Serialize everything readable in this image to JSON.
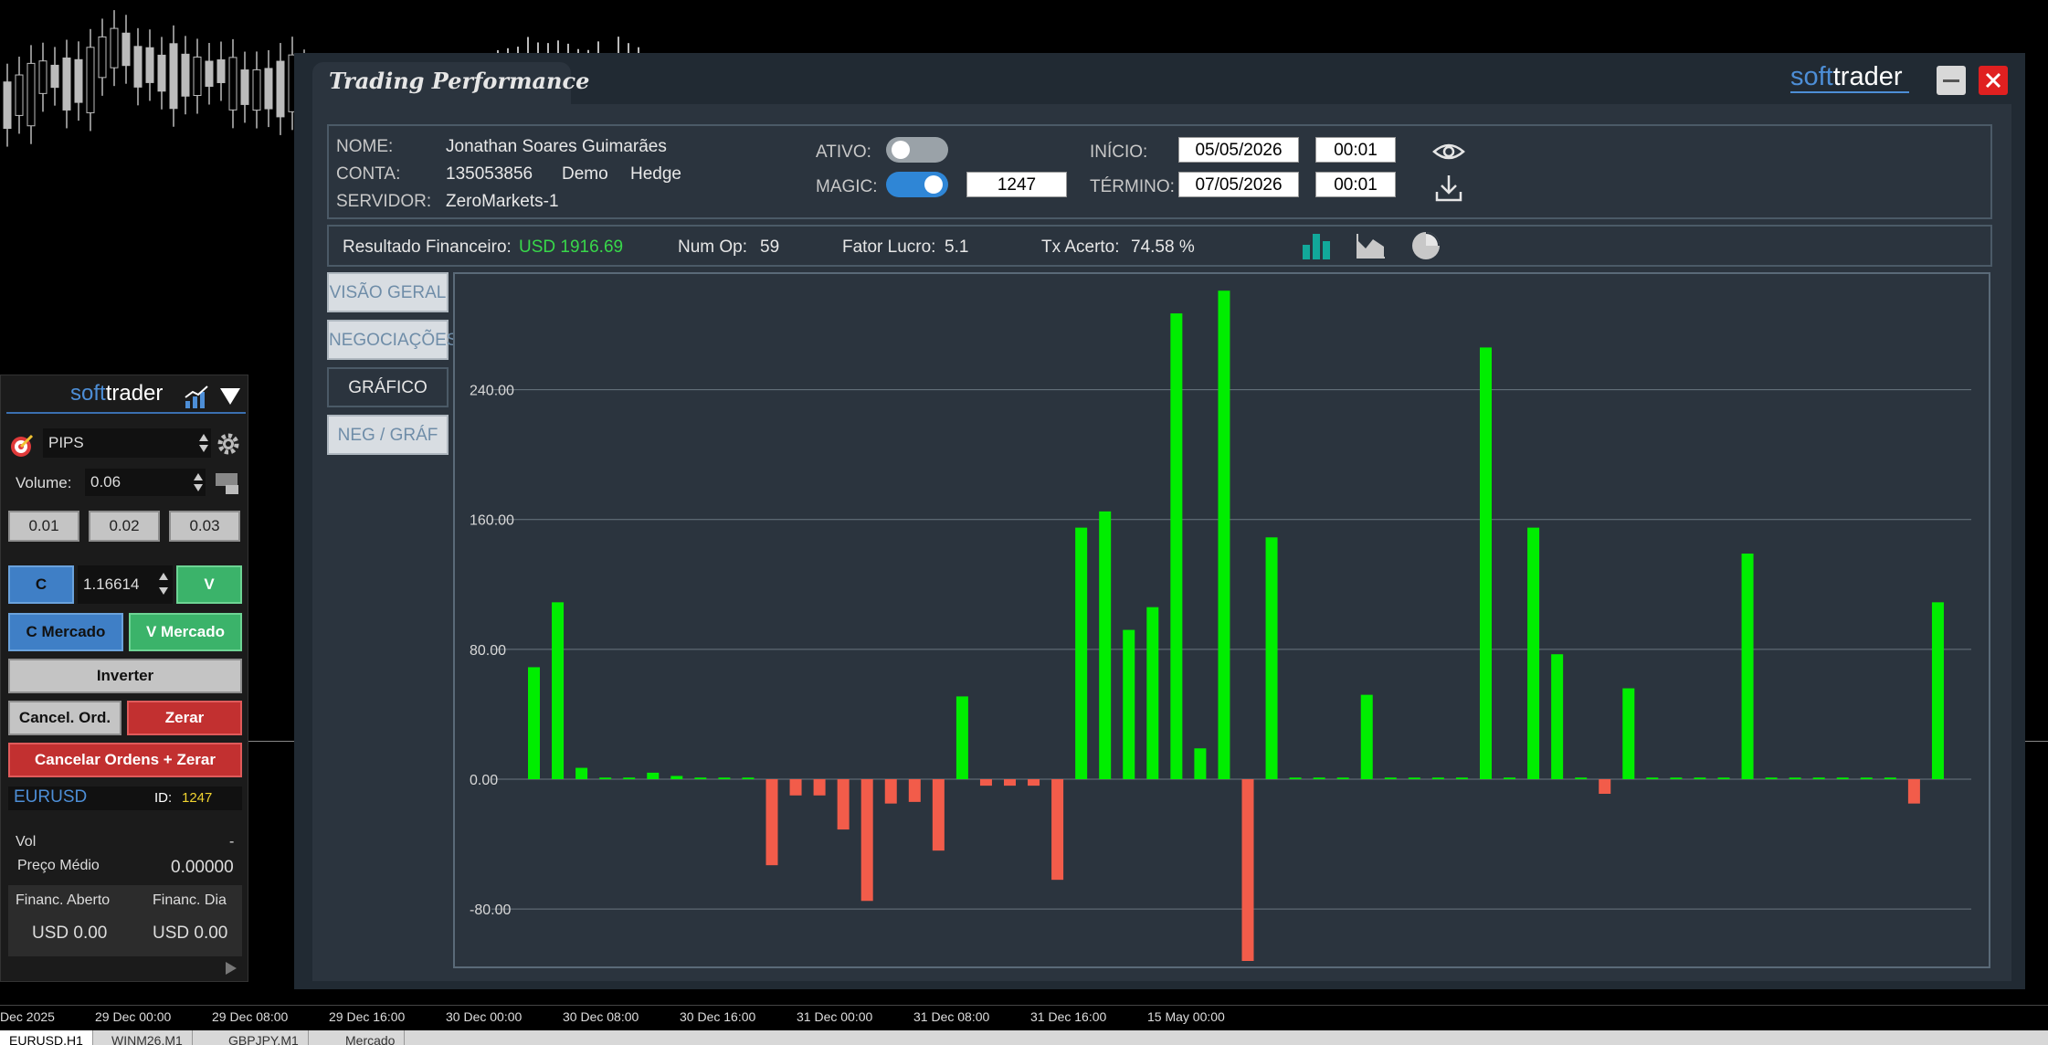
{
  "terminal": {
    "time_axis": [
      "Dec 2025",
      "29 Dec 00:00",
      "29 Dec 08:00",
      "29 Dec 16:00",
      "30 Dec 00:00",
      "30 Dec 08:00",
      "30 Dec 16:00",
      "31 Dec 00:00",
      "31 Dec 08:00",
      "31 Dec 16:00",
      "15 May 00:00"
    ],
    "bottom_tabs": [
      "EURUSD,H1",
      "WINM26,M1",
      "GBPJPY,M1",
      "Mercado"
    ]
  },
  "side_panel": {
    "brand_soft": "soft",
    "brand_trader": "trader",
    "mode_value": "PIPS",
    "volume_label": "Volume:",
    "volume_value": "0.06",
    "quick_volumes": [
      "0.01",
      "0.02",
      "0.03"
    ],
    "buy_label": "C",
    "price_value": "1.16614",
    "sell_label": "V",
    "market_buy": "C Mercado",
    "market_sell": "V Mercado",
    "invert": "Inverter",
    "cancel_orders": "Cancel. Ord.",
    "zero": "Zerar",
    "cancel_and_zero": "Cancelar Ordens + Zerar",
    "symbol": "EURUSD",
    "id_label": "ID:",
    "id_value": "1247",
    "vol_label": "Vol",
    "vol_value": "-",
    "avg_price_label": "Preço Médio",
    "avg_price_value": "0.00000",
    "open_fin_label": "Financ. Aberto",
    "day_fin_label": "Financ. Dia",
    "open_fin_value": "USD 0.00",
    "day_fin_value": "USD 0.00"
  },
  "window": {
    "title": "Trading Performance",
    "brand_soft": "soft",
    "brand_trader": "trader"
  },
  "account": {
    "name_label": "NOME:",
    "name_value": "Jonathan Soares Guimarães",
    "account_label": "CONTA:",
    "account_value": "135053856",
    "account_type": "Demo",
    "account_mode": "Hedge",
    "server_label": "SERVIDOR:",
    "server_value": "ZeroMarkets-1",
    "active_label": "ATIVO:",
    "active_on": false,
    "magic_label": "MAGIC:",
    "magic_on": true,
    "magic_value": "1247",
    "start_label": "INÍCIO:",
    "start_date": "05/05/2026",
    "start_time": "00:01",
    "end_label": "TÉRMINO:",
    "end_date": "07/05/2026",
    "end_time": "00:01"
  },
  "stats": {
    "result_label": "Resultado Financeiro:",
    "result_value": "USD 1916.69",
    "numop_label": "Num Op:",
    "numop_value": "59",
    "profit_factor_label": "Fator Lucro:",
    "profit_factor_value": "5.1",
    "hit_rate_label": "Tx Acerto:",
    "hit_rate_value": "74.58 %"
  },
  "nav": {
    "overview": "VISÃO GERAL",
    "trades": "NEGOCIAÇÕES",
    "chart": "GRÁFICO",
    "trades_chart": "NEG / GRÁF"
  },
  "colors": {
    "positive": "#00ee00",
    "negative": "#f25c4a",
    "accent_blue": "#2f86d6",
    "result_green": "#38d84a"
  },
  "chart_data": {
    "type": "bar",
    "ylim": [
      -112,
      300
    ],
    "yticks": [
      -80,
      0,
      80,
      160,
      240
    ],
    "ytick_labels": [
      "-80.00",
      "0.00",
      "80.00",
      "160.00",
      "240.00"
    ],
    "grid": true,
    "values": [
      69,
      109,
      7,
      1,
      1,
      4,
      2,
      1,
      1,
      1,
      -53,
      -10,
      -10,
      -31,
      -75,
      -15,
      -14,
      -44,
      51,
      -4,
      -4,
      -4,
      -62,
      155,
      165,
      92,
      106,
      287,
      19,
      301,
      -112,
      149,
      1,
      1,
      1,
      52,
      1,
      1,
      1,
      1,
      266,
      1,
      155,
      77,
      1,
      -9,
      56,
      1,
      1,
      1,
      1,
      139,
      1,
      1,
      1,
      1,
      1,
      1,
      -15,
      109
    ]
  }
}
